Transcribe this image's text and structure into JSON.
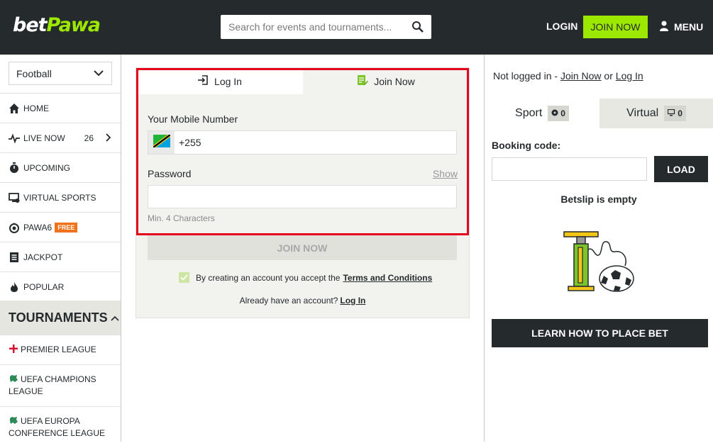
{
  "header": {
    "logo_bet": "bet",
    "logo_pawa": "Pawa",
    "search_placeholder": "Search for events and tournaments...",
    "login_label": "LOGIN",
    "join_label": "JOIN NOW",
    "menu_label": "MENU"
  },
  "sidebar": {
    "sport_selected": "Football",
    "items": [
      {
        "label": "HOME",
        "icon": "home-icon"
      },
      {
        "label": "LIVE NOW",
        "icon": "pulse-icon",
        "count": "26"
      },
      {
        "label": "UPCOMING",
        "icon": "stopwatch-icon"
      },
      {
        "label": "VIRTUAL SPORTS",
        "icon": "monitor-icon"
      },
      {
        "label": "PAWA6",
        "icon": "pawa6-icon",
        "badge": "FREE"
      },
      {
        "label": "JACKPOT",
        "icon": "jackpot-icon"
      },
      {
        "label": "POPULAR",
        "icon": "flame-icon"
      }
    ],
    "tournaments_title": "TOURNAMENTS",
    "tournaments": [
      {
        "label": "PREMIER LEAGUE",
        "icon": "england-flag-icon"
      },
      {
        "label": "UEFA CHAMPIONS LEAGUE",
        "icon": "europe-map-icon"
      },
      {
        "label": "UEFA EUROPA CONFERENCE LEAGUE",
        "icon": "europe-map-icon"
      }
    ]
  },
  "auth": {
    "tab_login": "Log In",
    "tab_join": "Join Now",
    "mobile_label": "Your Mobile Number",
    "phone_value": "+255",
    "password_label": "Password",
    "show_label": "Show",
    "password_hint": "Min. 4 Characters",
    "join_button": "JOIN NOW",
    "terms_prefix": "By creating an account you accept the",
    "terms_link": "Terms and Conditions",
    "already_text": "Already have an account?",
    "already_link": "Log In"
  },
  "betslip": {
    "status_prefix": "Not logged in - ",
    "status_join": "Join Now",
    "status_or": " or ",
    "status_login": "Log In",
    "tab_sport": "Sport",
    "sport_count": "0",
    "tab_virtual": "Virtual",
    "virtual_count": "0",
    "booking_label": "Booking code:",
    "load_button": "LOAD",
    "empty_text": "Betslip is empty",
    "learn_button": "LEARN HOW TO PLACE BET"
  },
  "colors": {
    "brand_dark": "#252a2d",
    "brand_green": "#9ce800",
    "highlight_red": "#e5001c",
    "free_orange": "#f0731b"
  }
}
